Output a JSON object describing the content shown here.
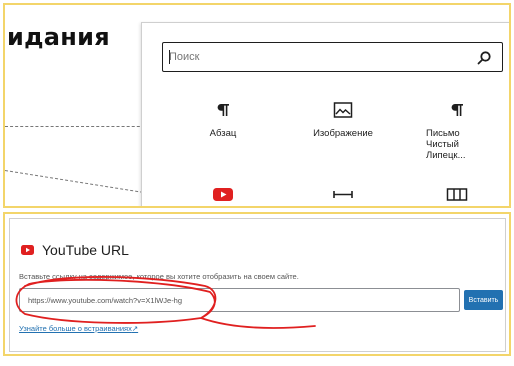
{
  "editor": {
    "heading_fragment": "идания"
  },
  "inserter": {
    "search": {
      "placeholder": "Поиск",
      "icon": "search-icon"
    },
    "blocks": [
      {
        "label": "Абзац",
        "icon": "paragraph-icon"
      },
      {
        "label": "Изображение",
        "icon": "image-icon"
      },
      {
        "label": "Письмо Чистый Липецк...",
        "icon": "paragraph-icon"
      },
      {
        "label": "",
        "icon": "youtube-icon"
      },
      {
        "label": "",
        "icon": "horizontal-rule-icon"
      },
      {
        "label": "",
        "icon": "columns-icon"
      }
    ]
  },
  "embed": {
    "title": "YouTube URL",
    "icon": "youtube-icon",
    "instructions": "Вставьте ссылку на содержимое, которое вы хотите отобразить на своем сайте.",
    "url_value": "https://www.youtube.com/watch?v=X1lWJe-hg",
    "button_label": "Вставить",
    "learn_more": "Узнайте больше о встраиваниях"
  },
  "colors": {
    "youtube_red": "#e02020",
    "accent_blue": "#2271b1",
    "frame_yellow": "#f3d56a",
    "annotation_red": "#e02020"
  }
}
